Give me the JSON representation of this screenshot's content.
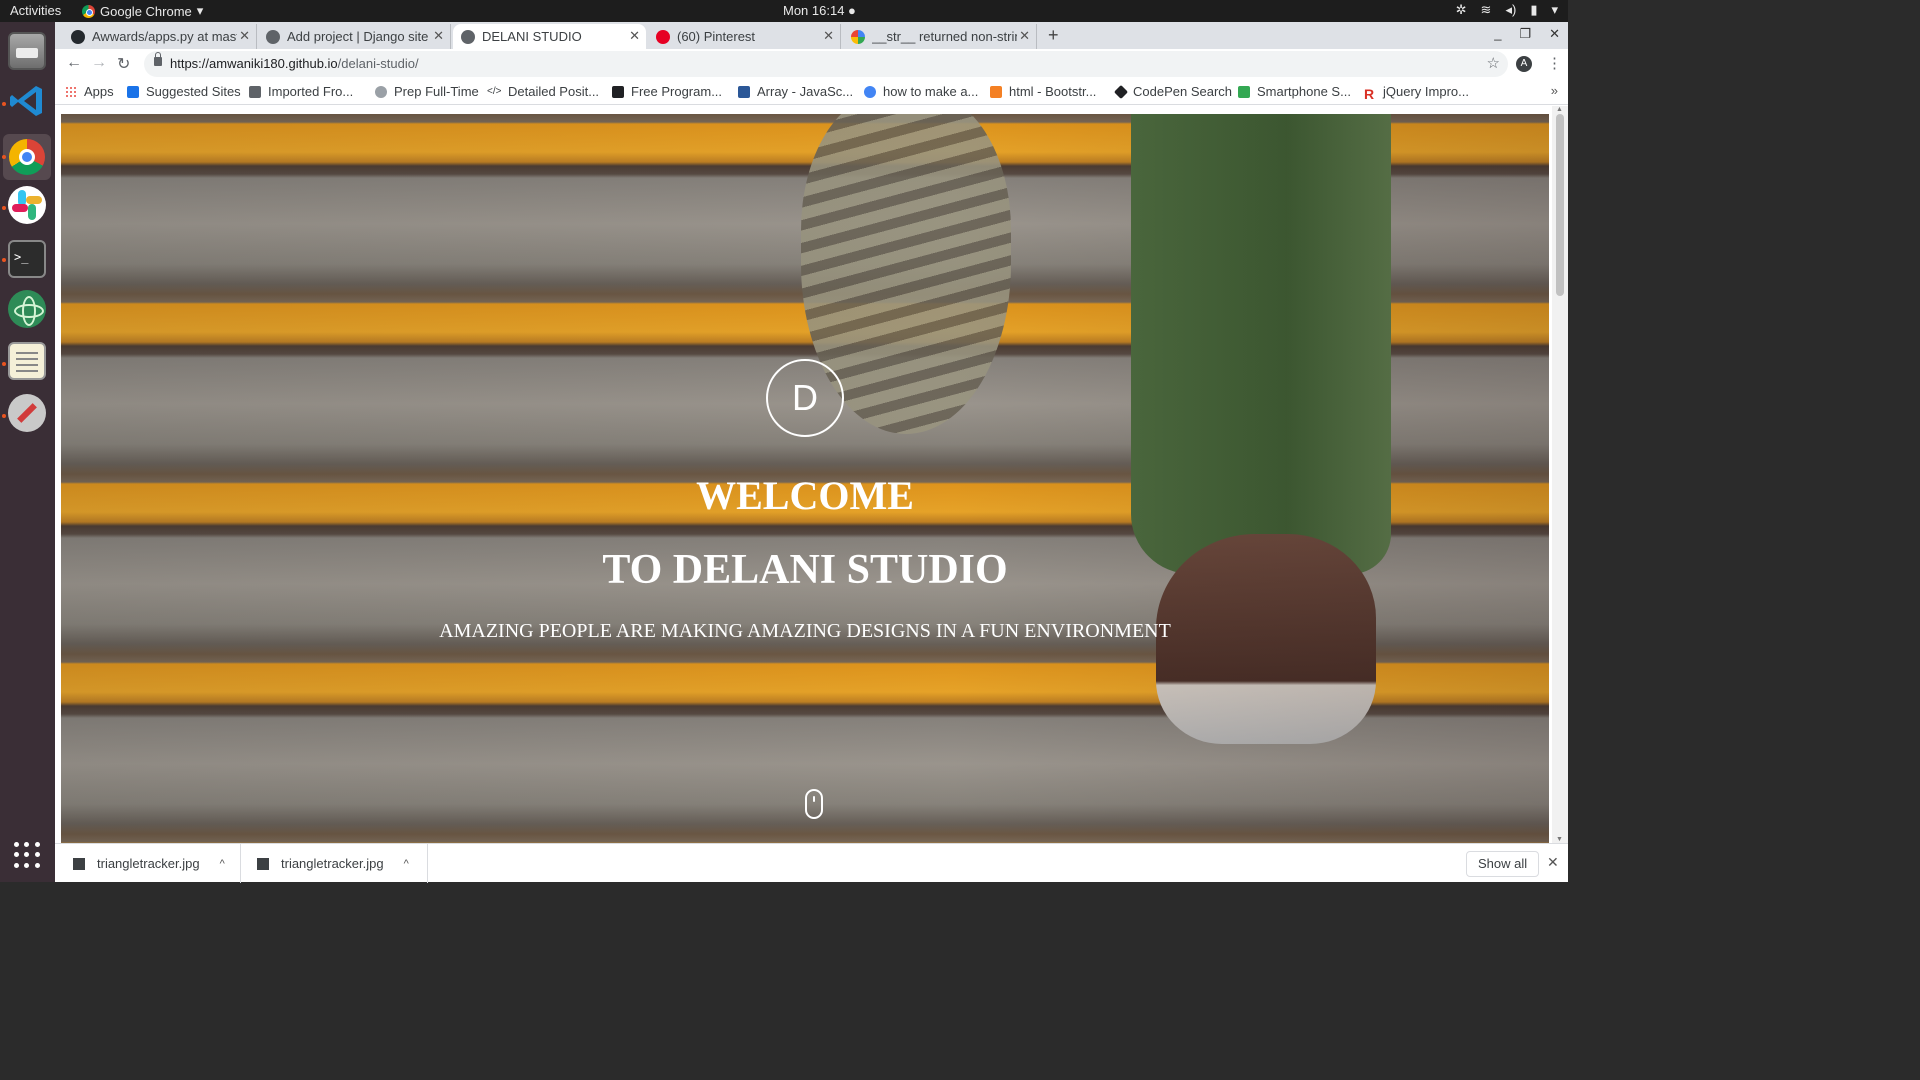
{
  "system": {
    "activities": "Activities",
    "app_name": "Google Chrome",
    "clock": "Mon 16:14 ●"
  },
  "tabs": [
    {
      "title": "Awwards/apps.py at mast",
      "icon": "github-icon"
    },
    {
      "title": "Add project | Django site",
      "icon": "globe-icon"
    },
    {
      "title": "DELANI STUDIO",
      "icon": "globe-icon",
      "active": true
    },
    {
      "title": "(60) Pinterest",
      "icon": "pinterest-icon"
    },
    {
      "title": "__str__ returned non-strin",
      "icon": "google-icon"
    }
  ],
  "address_bar": {
    "host": "https://amwaniki180.github.io",
    "path": "/delani-studio/"
  },
  "profile_initial": "A",
  "bookmarks": [
    {
      "label": "Apps",
      "color": "#e8453c"
    },
    {
      "label": "Suggested Sites",
      "color": "#1a73e8"
    },
    {
      "label": "Imported Fro...",
      "color": "#5f6368"
    },
    {
      "label": "Prep Full-Time",
      "color": "#9aa0a6"
    },
    {
      "label": "Detailed Posit...",
      "color": "#3c4043"
    },
    {
      "label": "Free Program...",
      "color": "#202124"
    },
    {
      "label": "Array - JavaSc...",
      "color": "#2b5797"
    },
    {
      "label": "how to make a...",
      "color": "#4285f4"
    },
    {
      "label": "html - Bootstr...",
      "color": "#f48024"
    },
    {
      "label": "CodePen Search",
      "color": "#202124"
    },
    {
      "label": "Smartphone S...",
      "color": "#34a853"
    },
    {
      "label": "jQuery Impro...",
      "color": "#d93025"
    }
  ],
  "hero": {
    "logo_letter": "D",
    "welcome": "WELCOME",
    "studio": "TO DELANI STUDIO",
    "tagline": "AMAZING PEOPLE ARE MAKING AMAZING DESIGNS IN A FUN ENVIRONMENT"
  },
  "downloads": [
    {
      "filename": "triangletracker.jpg"
    },
    {
      "filename": "triangletracker.jpg"
    }
  ],
  "show_all_label": "Show all"
}
